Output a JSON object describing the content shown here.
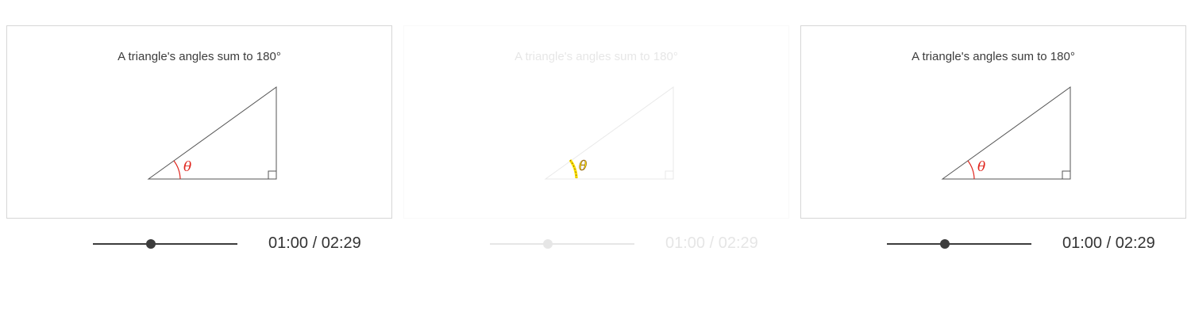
{
  "panels": [
    {
      "title": "A triangle's angles sum to 180°",
      "angle_label": "θ",
      "playback": {
        "progress": 0.4,
        "time": "01:00 / 02:29"
      },
      "state": "normal"
    },
    {
      "title": "A triangle's angles sum to 180°",
      "angle_label": "θ",
      "playback": {
        "progress": 0.4,
        "time": "01:00 / 02:29"
      },
      "state": "faded",
      "highlight_color": "#ffe600"
    },
    {
      "title": "A triangle's angles sum to 180°",
      "angle_label": "θ",
      "playback": {
        "progress": 0.4,
        "time": "01:00 / 02:29"
      },
      "state": "normal"
    }
  ],
  "colors": {
    "text": "#3c3c3c",
    "angle": "#e0261e",
    "border": "#d6d6d6"
  },
  "icons": {
    "right_angle": "right-angle-marker-icon",
    "slider_thumb": "circle-handle-icon"
  }
}
